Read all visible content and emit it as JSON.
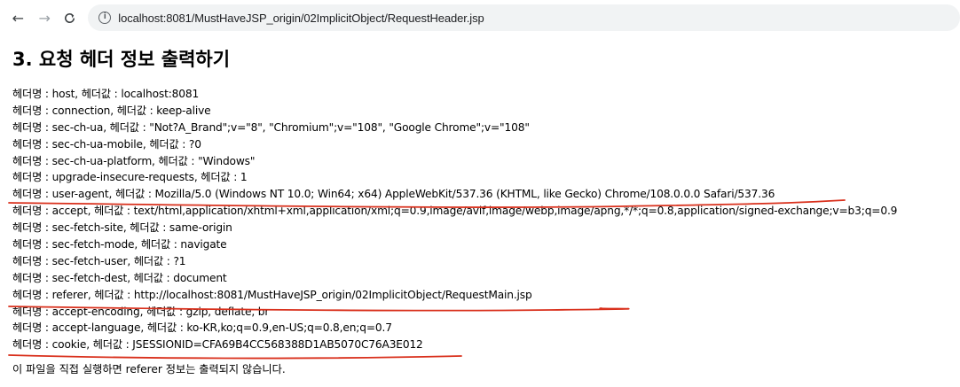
{
  "browser": {
    "back_icon": "←",
    "forward_icon": "→",
    "reload_icon": "C",
    "info_icon": "i",
    "url": "localhost:8081/MustHaveJSP_origin/02ImplicitObject/RequestHeader.jsp"
  },
  "page": {
    "title": "3. 요청 헤더 정보 출력하기",
    "headers": [
      "헤더명 : host, 헤더값 : localhost:8081",
      "헤더명 : connection, 헤더값 : keep-alive",
      "헤더명 : sec-ch-ua, 헤더값 : \"Not?A_Brand\";v=\"8\", \"Chromium\";v=\"108\", \"Google Chrome\";v=\"108\"",
      "헤더명 : sec-ch-ua-mobile, 헤더값 : ?0",
      "헤더명 : sec-ch-ua-platform, 헤더값 : \"Windows\"",
      "헤더명 : upgrade-insecure-requests, 헤더값 : 1",
      "헤더명 : user-agent, 헤더값 : Mozilla/5.0 (Windows NT 10.0; Win64; x64) AppleWebKit/537.36 (KHTML, like Gecko) Chrome/108.0.0.0 Safari/537.36",
      "헤더명 : accept, 헤더값 : text/html,application/xhtml+xml,application/xml;q=0.9,image/avif,image/webp,image/apng,*/*;q=0.8,application/signed-exchange;v=b3;q=0.9",
      "헤더명 : sec-fetch-site, 헤더값 : same-origin",
      "헤더명 : sec-fetch-mode, 헤더값 : navigate",
      "헤더명 : sec-fetch-user, 헤더값 : ?1",
      "헤더명 : sec-fetch-dest, 헤더값 : document",
      "헤더명 : referer, 헤더값 : http://localhost:8081/MustHaveJSP_origin/02ImplicitObject/RequestMain.jsp",
      "헤더명 : accept-encoding, 헤더값 : gzip, deflate, br",
      "헤더명 : accept-language, 헤더값 : ko-KR,ko;q=0.9,en-US;q=0.8,en;q=0.7",
      "헤더명 : cookie, 헤더값 : JSESSIONID=CFA69B4CC568388D1AB5070C76A3E012"
    ],
    "footer_note": "이 파일을 직접 실행하면 referer 정보는 출력되지 않습니다."
  },
  "annotation_color": "#d9301c"
}
